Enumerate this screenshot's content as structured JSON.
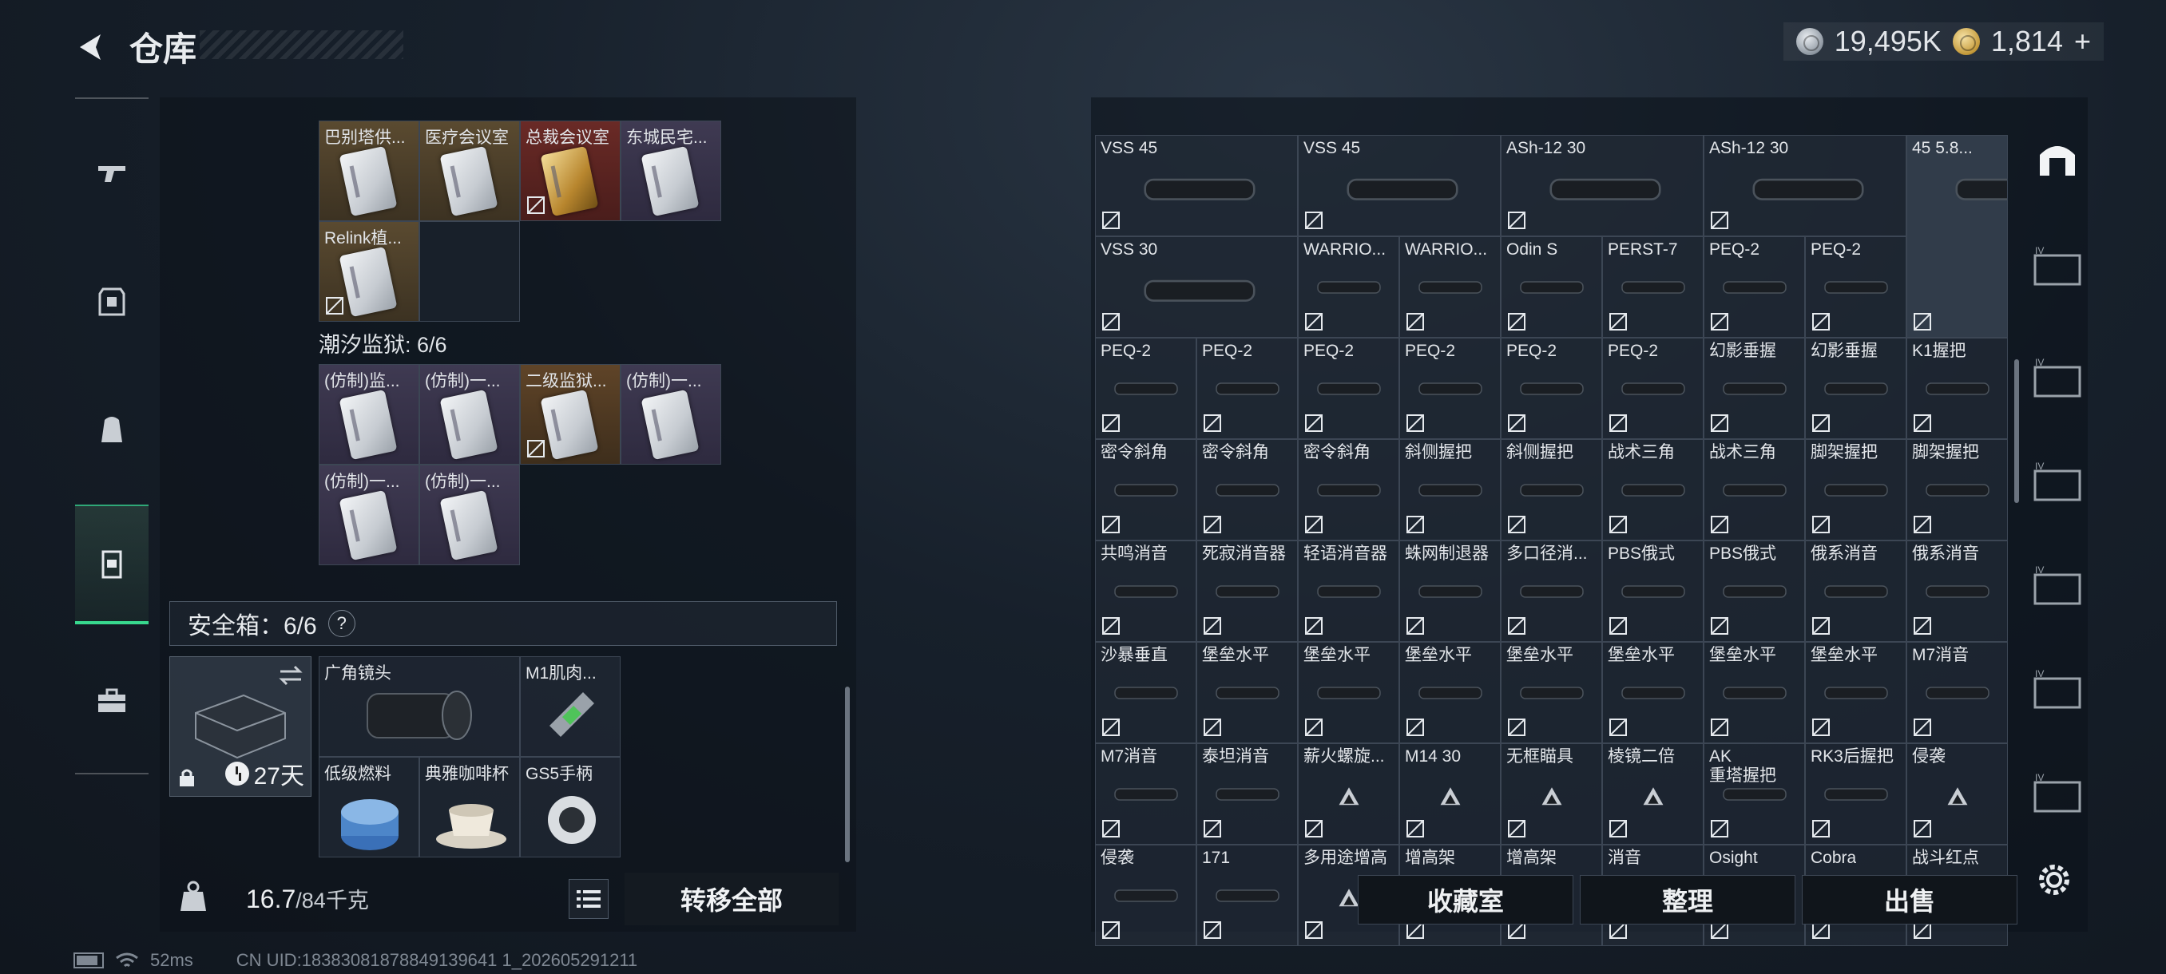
{
  "header": {
    "title": "仓库",
    "back_icon": "back-arrow-icon"
  },
  "currency": {
    "silver_amount": "19,495K",
    "gold_amount": "1,814",
    "add_symbol": "+"
  },
  "sidebar": {
    "items": [
      {
        "icon": "gun-icon"
      },
      {
        "icon": "armor-icon"
      },
      {
        "icon": "backpack-icon"
      },
      {
        "icon": "vest-icon",
        "active": true
      },
      {
        "icon": "toolbox-icon"
      }
    ]
  },
  "keycards": {
    "top_row": [
      "巴别塔供...",
      "医疗会议室",
      "总裁会议室",
      "东城民宅..."
    ],
    "second_row": [
      "Relink植..."
    ],
    "tidal_prison_label": "潮汐监狱: 6/6",
    "prison_row1": [
      "(仿制)监...",
      "(仿制)一...",
      "二级监狱...",
      "(仿制)一..."
    ],
    "prison_row2": [
      "(仿制)一...",
      "(仿制)一..."
    ]
  },
  "safe": {
    "header": "安全箱：6/6",
    "help": "?",
    "days": "27天",
    "items": [
      "广角镜头",
      "M1肌肉...",
      "低级燃料",
      "典雅咖啡杯",
      "GS5手柄"
    ]
  },
  "footer": {
    "weight_current": "16.7",
    "weight_max": "/84千克",
    "transfer_all": "转移全部"
  },
  "status_bar": {
    "ping": "52ms",
    "uid": "CN UID:18383081878849139641 1_202605291211"
  },
  "stash": {
    "rows": [
      [
        "VSS 45",
        "VSS 45",
        "ASh-12 30",
        "ASh-12 30",
        "45 5.8..."
      ],
      [
        "VSS 30",
        "WARRIO...",
        "WARRIO...",
        "Odin S",
        "PERST-7",
        "PEQ-2",
        "PEQ-2"
      ],
      [
        "PEQ-2",
        "PEQ-2",
        "PEQ-2",
        "PEQ-2",
        "PEQ-2",
        "PEQ-2",
        "幻影垂握",
        "幻影垂握",
        "K1握把"
      ],
      [
        "密令斜角",
        "密令斜角",
        "密令斜角",
        "斜侧握把",
        "斜侧握把",
        "战术三角",
        "战术三角",
        "脚架握把",
        "脚架握把"
      ],
      [
        "共鸣消音",
        "死寂消音器",
        "轻语消音器",
        "蛛网制退器",
        "多口径消...",
        "PBS俄式",
        "PBS俄式",
        "俄系消音",
        "俄系消音"
      ],
      [
        "沙暴垂直",
        "堡垒水平",
        "堡垒水平",
        "堡垒水平",
        "堡垒水平",
        "堡垒水平",
        "堡垒水平",
        "堡垒水平",
        "M7消音"
      ],
      [
        "M7消音",
        "泰坦消音",
        "薪火螺旋...",
        "M14 30",
        "无框瞄具",
        "棱镜二倍",
        "AK\n重塔握把",
        "RK3后握把",
        "侵袭"
      ],
      [
        "侵袭",
        "171",
        "多用途增高",
        "增高架",
        "增高架",
        "消音",
        "Osight",
        "Cobra",
        "战斗红点"
      ]
    ]
  },
  "actions": {
    "collection": "收藏室",
    "sort": "整理",
    "sell": "出售"
  }
}
